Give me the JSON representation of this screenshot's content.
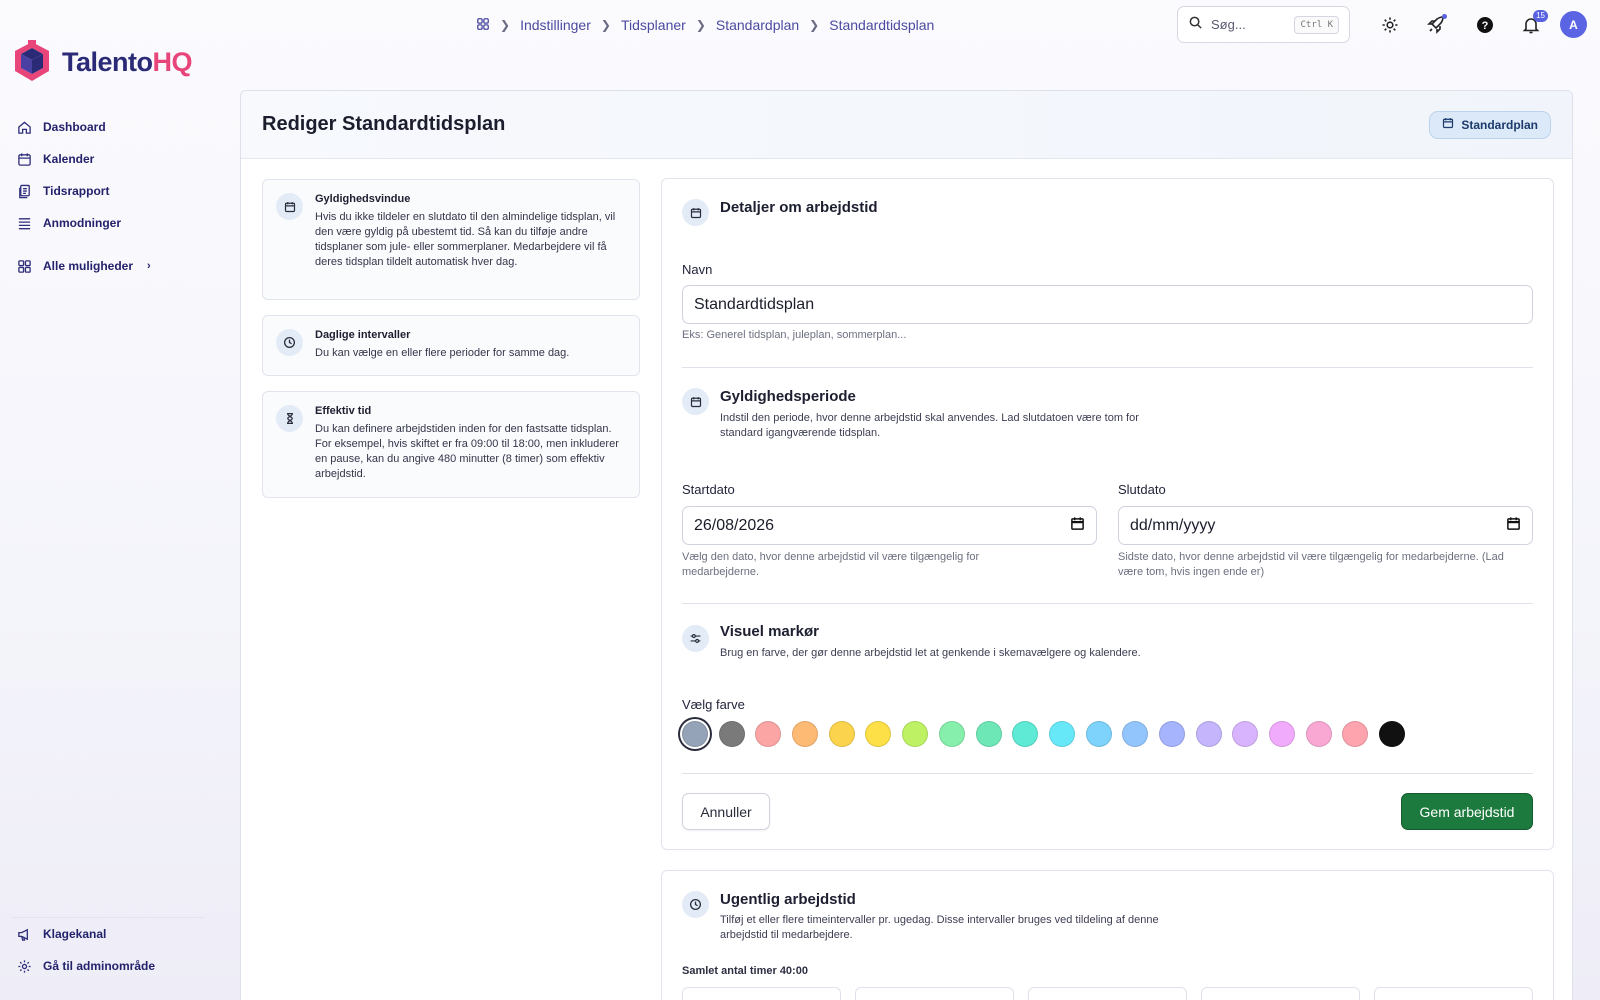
{
  "brand": {
    "name_a": "Talento",
    "name_b": "HQ",
    "colors": {
      "primary": "#2b2a76",
      "accent": "#e8457a",
      "save": "#1d7a3e"
    }
  },
  "sidebar": {
    "items": [
      {
        "label": "Dashboard",
        "icon": "home-icon"
      },
      {
        "label": "Kalender",
        "icon": "calendar-icon"
      },
      {
        "label": "Tidsrapport",
        "icon": "report-icon"
      },
      {
        "label": "Anmodninger",
        "icon": "list-icon"
      }
    ],
    "more": "Alle muligheder",
    "bottom": [
      {
        "label": "Klagekanal",
        "icon": "megaphone-icon"
      },
      {
        "label": "Gå til adminområde",
        "icon": "gear-icon"
      }
    ]
  },
  "breadcrumb": [
    "Indstillinger",
    "Tidsplaner",
    "Standardplan",
    "Standardtidsplan"
  ],
  "topbar": {
    "search_placeholder": "Søg...",
    "shortcut": "Ctrl K",
    "notifications_count": "15",
    "avatar_initial": "A"
  },
  "page": {
    "title": "Rediger Standardtidsplan",
    "chip": "Standardplan"
  },
  "info_cards": [
    {
      "title": "Gyldighedsvindue",
      "text": "Hvis du ikke tildeler en slutdato til den almindelige tidsplan, vil den være gyldig på ubestemt tid. Så kan du tilføje andre tidsplaner som jule- eller sommerplaner. Medarbejdere vil få deres tidsplan tildelt automatisk hver dag.",
      "icon": "calendar-icon"
    },
    {
      "title": "Daglige intervaller",
      "text": "Du kan vælge en eller flere perioder for samme dag.",
      "icon": "clock-icon"
    },
    {
      "title": "Effektiv tid",
      "text": "Du kan definere arbejdstiden inden for den fastsatte tidsplan. For eksempel, hvis skiftet er fra 09:00 til 18:00, men inkluderer en pause, kan du angive 480 minutter (8 timer) som effektiv arbejdstid.",
      "icon": "hourglass-icon"
    }
  ],
  "form": {
    "details_title": "Detaljer om arbejdstid",
    "name_label": "Navn",
    "name_value": "Standardtidsplan",
    "name_hint": "Eks: Generel tidsplan, juleplan, sommerplan...",
    "validity_title": "Gyldighedsperiode",
    "validity_desc": "Indstil den periode, hvor denne arbejdstid skal anvendes. Lad slutdatoen være tom for standard igangværende tidsplan.",
    "start_label": "Startdato",
    "start_value": "26/08/2026",
    "start_hint": "Vælg den dato, hvor denne arbejdstid vil være tilgængelig for medarbejderne.",
    "end_label": "Slutdato",
    "end_value": "dd/mm/yyyy",
    "end_hint": "Sidste dato, hvor denne arbejdstid vil være tilgængelig for medarbejderne. (Lad være tom, hvis ingen ende er)",
    "marker_title": "Visuel markør",
    "marker_desc": "Brug en farve, der gør denne arbejdstid let at genkende i skemavælgere og kalendere.",
    "color_label": "Vælg farve",
    "colors": [
      "#94a3b8",
      "#7a7a7a",
      "#fca5a5",
      "#fdba74",
      "#fcd34d",
      "#fde047",
      "#bef264",
      "#86efac",
      "#6ee7b7",
      "#5eead4",
      "#67e8f9",
      "#7dd3fc",
      "#93c5fd",
      "#a5b4fc",
      "#c4b5fd",
      "#d8b4fe",
      "#f0abfc",
      "#f9a8d4",
      "#fda4af",
      "#111111"
    ],
    "selected_color": "#94a3b8",
    "cancel": "Annuller",
    "save": "Gem arbejdstid"
  },
  "weekly": {
    "title": "Ugentlig arbejdstid",
    "desc": "Tilføj et eller flere timeintervaller pr. ugedag. Disse intervaller bruges ved tildeling af denne arbejdstid til medarbejdere.",
    "total": "Samlet antal timer 40:00"
  }
}
